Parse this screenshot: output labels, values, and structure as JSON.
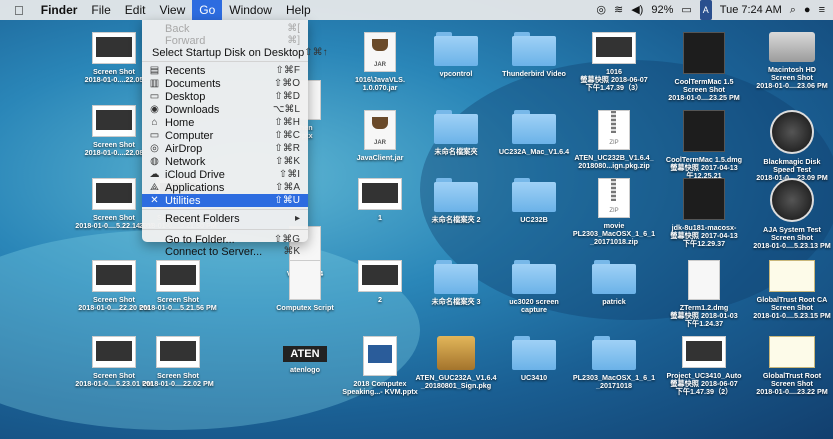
{
  "menubar": {
    "apple": "",
    "items": [
      "Finder",
      "File",
      "Edit",
      "View",
      "Go",
      "Window",
      "Help"
    ],
    "active": "Go",
    "battery": "92%",
    "input_flag": "A",
    "time": "Tue 7:24 AM"
  },
  "go_menu": {
    "items": [
      {
        "label": "Back",
        "shortcut": "⌘[",
        "disabled": true
      },
      {
        "label": "Forward",
        "shortcut": "⌘]",
        "disabled": true
      },
      {
        "label": "Select Startup Disk on Desktop",
        "shortcut": "⇧⌘↑"
      },
      {
        "label": "Recents",
        "shortcut": "⇧⌘F",
        "icon": "recents-icon"
      },
      {
        "label": "Documents",
        "shortcut": "⇧⌘O",
        "icon": "documents-icon"
      },
      {
        "label": "Desktop",
        "shortcut": "⇧⌘D",
        "icon": "desktop-icon"
      },
      {
        "label": "Downloads",
        "shortcut": "⌥⌘L",
        "icon": "downloads-icon"
      },
      {
        "label": "Home",
        "shortcut": "⇧⌘H",
        "icon": "home-icon"
      },
      {
        "label": "Computer",
        "shortcut": "⇧⌘C",
        "icon": "computer-icon"
      },
      {
        "label": "AirDrop",
        "shortcut": "⇧⌘R",
        "icon": "airdrop-icon"
      },
      {
        "label": "Network",
        "shortcut": "⇧⌘K",
        "icon": "network-icon"
      },
      {
        "label": "iCloud Drive",
        "shortcut": "⇧⌘I",
        "icon": "icloud-icon"
      },
      {
        "label": "Applications",
        "shortcut": "⇧⌘A",
        "icon": "applications-icon"
      },
      {
        "label": "Utilities",
        "shortcut": "⇧⌘U",
        "icon": "utilities-icon",
        "highlighted": true
      },
      {
        "label": "Recent Folders",
        "shortcut": "▸"
      },
      {
        "label": "Go to Folder...",
        "shortcut": "⇧⌘G"
      },
      {
        "label": "Connect to Server...",
        "shortcut": "⌘K"
      }
    ]
  },
  "desktop": {
    "items": [
      {
        "kind": "shot",
        "line1": "Screen Shot",
        "line2": "2018-01-0....22.05"
      },
      {
        "kind": "shot",
        "line1": "Screen Shot",
        "line2": "2018-01-0....22.08"
      },
      {
        "kind": "shot",
        "line1": "Screen Shot",
        "line2": "2018-01-0....5.22.14 PM"
      },
      {
        "kind": "shot",
        "line1": "Screen Shot",
        "line2": "2018-01-0....22.20 PM"
      },
      {
        "kind": "shot",
        "line1": "Screen Shot",
        "line2": "2018-01-0....5.23.01 PM"
      },
      {
        "kind": "shot",
        "line1": "Screen Shot",
        "line2": "2018-01-0....5.21.50 PM"
      },
      {
        "kind": "shot",
        "line1": "Screen Shot",
        "line2": "2018-01-0....5.21.56 PM"
      },
      {
        "kind": "shot",
        "line1": "Screen Shot",
        "line2": "2018-01-0....22.02 PM"
      },
      {
        "kind": "doc",
        "line1": "then",
        "line2": "pptx"
      },
      {
        "kind": "doc",
        "line1": "Video.mp4",
        "line2": ""
      },
      {
        "kind": "doc",
        "line1": "Computex Script",
        "line2": ""
      },
      {
        "kind": "aten",
        "line1": "atenlogo",
        "line2": ""
      },
      {
        "kind": "jar",
        "line1": "1016\\JavaVLS.",
        "line2": "1.0.070.jar"
      },
      {
        "kind": "jar",
        "line1": "JavaClient.jar",
        "line2": ""
      },
      {
        "kind": "shot",
        "line1": "1",
        "line2": ""
      },
      {
        "kind": "shot",
        "line1": "2",
        "line2": ""
      },
      {
        "kind": "ppt",
        "line1": "2018 Computex",
        "line2": "Speaking...- KVM.pptx"
      },
      {
        "kind": "folder",
        "line1": "vpcontrol",
        "line2": ""
      },
      {
        "kind": "folder",
        "line1": "未命名檔案夾",
        "line2": ""
      },
      {
        "kind": "folder",
        "line1": "未命名檔案夾 2",
        "line2": ""
      },
      {
        "kind": "folder",
        "line1": "未命名檔案夾 3",
        "line2": ""
      },
      {
        "kind": "pkg",
        "line1": "ATEN_GUC232A_V1.6.4",
        "line2": "_20180801_Sign.pkg"
      },
      {
        "kind": "folder",
        "line1": "Thunderbird Video",
        "line2": ""
      },
      {
        "kind": "folder",
        "line1": "UC232A_Mac_V1.6.4",
        "line2": ""
      },
      {
        "kind": "folder",
        "line1": "UC232B",
        "line2": ""
      },
      {
        "kind": "folder",
        "line1": "uc3020 screen",
        "line2": "capture"
      },
      {
        "kind": "folder",
        "line1": "UC3410",
        "line2": ""
      },
      {
        "kind": "shot",
        "line1": "1016",
        "line2": "螢幕快照 2018-06-07",
        "line3": "下午1.47.39（3）"
      },
      {
        "kind": "zip",
        "line1": "ATEN_UC232B_V1.6.4_",
        "line2": "2018080...ign.pkg.zip"
      },
      {
        "kind": "zip",
        "line1": "movie",
        "line2": "PL2303_MacOSX_1_6_1",
        "line3": "_20171018.zip"
      },
      {
        "kind": "folder",
        "line1": "patrick",
        "line2": ""
      },
      {
        "kind": "folder",
        "line1": "PL2303_MacOSX_1_6_1",
        "line2": "_20171018"
      },
      {
        "kind": "term",
        "line1": "CoolTermMac 1.5",
        "line2": "Screen Shot",
        "line3": "2018-01-0....23.25 PM"
      },
      {
        "kind": "term",
        "line1": "CoolTermMac 1.5.dmg",
        "line2": "螢幕快照 2017-04-13",
        "line3": "午12.25.21"
      },
      {
        "kind": "term",
        "line1": "jdk-8u181-macosx-",
        "line2": "螢幕快照 2017-04-13",
        "line3": "下午12.29.37"
      },
      {
        "kind": "doc",
        "line1": "ZTerm1.2.dmg",
        "line2": "螢幕快照 2018-01-03",
        "line3": "下午1.24.37"
      },
      {
        "kind": "shot",
        "line1": "Project_UC3410_Auto",
        "line2": "螢幕快照 2018-06-07",
        "line3": "下午1.47.39（2）"
      },
      {
        "kind": "hd",
        "line1": "Macintosh HD",
        "line2": "Screen Shot",
        "line3": "2018-01-0....23.06 PM"
      },
      {
        "kind": "disk",
        "line1": "Blackmagic Disk",
        "line2": "Speed Test",
        "line3": "2018-01-0....23.09 PM"
      },
      {
        "kind": "disk",
        "line1": "AJA System Test",
        "line2": "Screen Shot",
        "line3": "2018-01-0....5.23.13 PM"
      },
      {
        "kind": "cert",
        "line1": "GlobalTrust Root CA",
        "line2": "Screen Shot",
        "line3": "2018-01-0....5.23.15 PM"
      },
      {
        "kind": "cert",
        "line1": "GlobalTrust Root",
        "line2": "Screen Shot",
        "line3": "2018-01-0....23.22 PM"
      }
    ]
  }
}
